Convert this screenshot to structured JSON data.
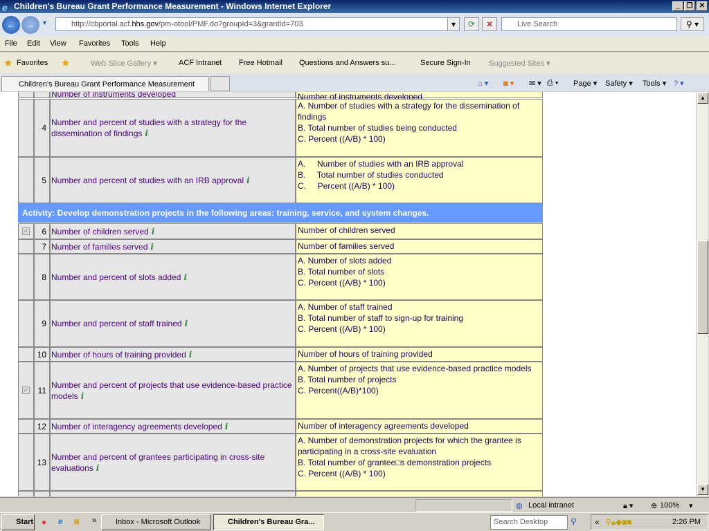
{
  "window": {
    "title": "Children's Bureau Grant Performance Measurement - Windows Internet Explorer"
  },
  "nav": {
    "url_prefix": "http://cbportal.acf.",
    "url_domain": "hhs.gov",
    "url_suffix": "/pm-otool/PMF.do?groupId=3&grantId=703",
    "search_placeholder": "Live Search"
  },
  "menu": [
    "File",
    "Edit",
    "View",
    "Favorites",
    "Tools",
    "Help"
  ],
  "favorites": {
    "label": "Favorites",
    "items": [
      "Web Slice Gallery ▾",
      "ACF Intranet",
      "Free Hotmail",
      "Questions and Answers su...",
      "Secure Sign-In",
      "Suggested Sites ▾"
    ]
  },
  "tab": {
    "label": "Children's Bureau Grant Performance Measurement"
  },
  "commands": [
    "Page ▾",
    "Safety ▾",
    "Tools ▾"
  ],
  "table": {
    "partial_top": {
      "measure": "Number of instruments developed",
      "data": "Number of instruments developed"
    },
    "rows_a": [
      {
        "num": "4",
        "measure": "Number and percent of studies with a strategy for the dissemination of findings",
        "data": [
          "A. Number of studies with a strategy for the dissemination of findings",
          "B. Total number of studies being conducted",
          "C. Percent ((A/B) * 100)"
        ],
        "checked": false
      },
      {
        "num": "5",
        "measure": "Number and percent of studies with an IRB approval",
        "data": [
          "A.     Number of studies with an IRB approval",
          "B.     Total number of studies conducted",
          "C.     Percent ((A/B) * 100)"
        ],
        "checked": false
      }
    ],
    "activity": "Activity: Develop demonstration projects in the following areas: training, service, and system changes.",
    "rows_b": [
      {
        "num": "6",
        "measure": "Number of children served",
        "data": [
          "Number of children served"
        ],
        "checked": true
      },
      {
        "num": "7",
        "measure": "Number of families served",
        "data": [
          "Number of families served"
        ],
        "checked": false
      },
      {
        "num": "8",
        "measure": "Number and percent of slots added",
        "data": [
          "A. Number of slots added",
          "B. Total number of slots",
          "C. Percent ((A/B) * 100)"
        ],
        "checked": false
      },
      {
        "num": "9",
        "measure": "Number and percent of staff trained",
        "data": [
          "A. Number of staff trained",
          "B. Total number of staff to sign-up for training",
          "C. Percent ((A/B) * 100)"
        ],
        "checked": false
      },
      {
        "num": "10",
        "measure": "Number of hours of training provided",
        "data": [
          "Number of hours of training provided"
        ],
        "checked": false
      },
      {
        "num": "11",
        "measure": "Number and percent of projects that use evidence-based practice models",
        "data": [
          "A. Number of projects that use evidence-based practice models",
          "B. Total number of projects",
          "C. Percent((A/B)*100)"
        ],
        "checked": true
      },
      {
        "num": "12",
        "measure": "Number of interagency agreements developed",
        "data": [
          "Number of interagency agreements developed"
        ],
        "checked": false
      },
      {
        "num": "13",
        "measure": "Number and percent of grantees participating in cross-site evaluations",
        "data": [
          "A. Number of demonstration projects for which the grantee is participating in a cross-site evaluation",
          "B. Total number of grantee□s demonstration projects",
          "C. Percent ((A/B) * 100)"
        ],
        "checked": false
      }
    ]
  },
  "status": {
    "zone": "Local intranet",
    "zoom": "100%"
  },
  "taskbar": {
    "start": "Start",
    "items": [
      "Inbox - Microsoft Outlook",
      "Children's Bureau Gra..."
    ],
    "search_placeholder": "Search Desktop",
    "clock": "2:26 PM"
  }
}
